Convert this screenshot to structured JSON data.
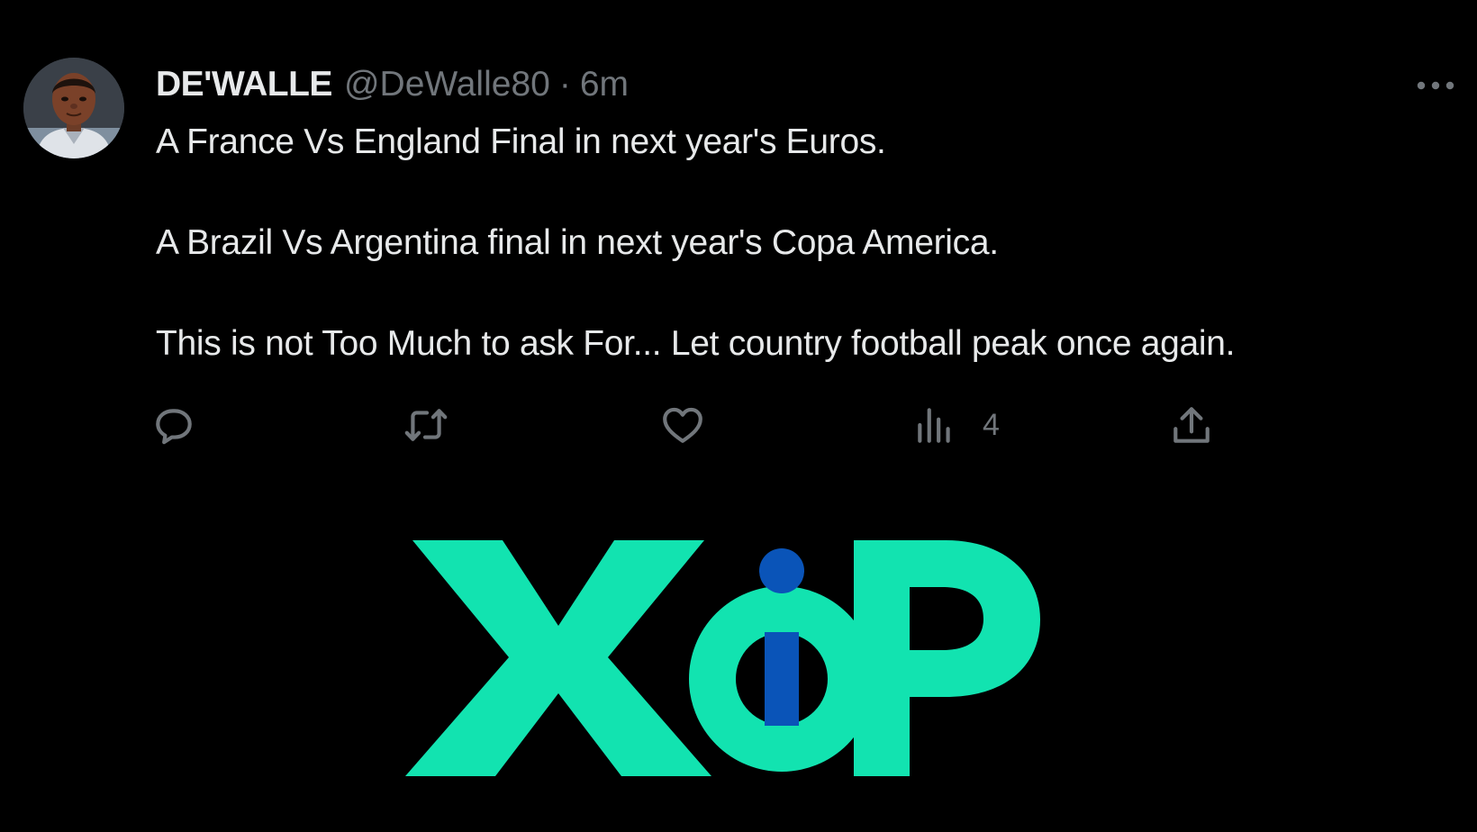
{
  "tweet": {
    "display_name": "DE'WALLE",
    "handle": "@DeWalle80",
    "separator": "·",
    "timestamp": "6m",
    "paragraphs": [
      "A France Vs England Final in next year's Euros.",
      "A Brazil Vs Argentina final in next year's Copa America.",
      "This is not Too Much to ask For... Let country football peak once again."
    ],
    "actions": {
      "reply_icon": "reply-bubble-icon",
      "retweet_icon": "retweet-icon",
      "like_icon": "heart-icon",
      "views_icon": "bar-chart-icon",
      "views_count": "4",
      "share_icon": "share-upload-icon"
    },
    "more_icon": "ellipsis-icon"
  },
  "logo": {
    "text": "XiP",
    "primary_color": "#12e3b0",
    "dot_color": "#0a54b8"
  },
  "colors": {
    "background": "#000000",
    "text_primary": "#e7e9ea",
    "text_secondary": "#71767b"
  }
}
